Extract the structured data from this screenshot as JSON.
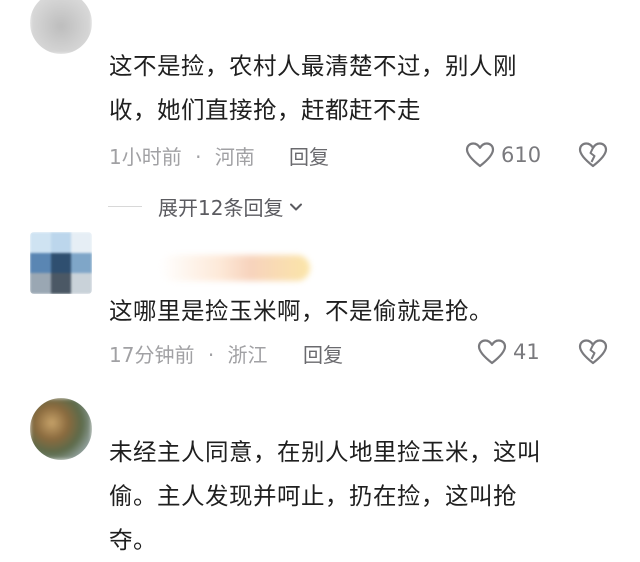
{
  "comments": [
    {
      "username": "",
      "text": "这不是捡，农村人最清楚不过，别人刚\n收，她们直接抢，赶都赶不走",
      "time": "1小时前",
      "location": "河南",
      "reply_label": "回复",
      "likes": "610",
      "expand_label": "展开12条回复",
      "avatar_icon": "blurred-avatar-icon",
      "like_icon": "heart-icon",
      "dislike_icon": "broken-heart-icon"
    },
    {
      "username": "",
      "text": "这哪里是捡玉米啊，不是偷就是抢。",
      "time": "17分钟前",
      "location": "浙江",
      "reply_label": "回复",
      "likes": "41",
      "avatar_icon": "pixelated-avatar-icon",
      "like_icon": "heart-icon",
      "dislike_icon": "broken-heart-icon"
    },
    {
      "username": "",
      "text": "未经主人同意，在别人地里捡玉米，这叫\n偷。主人发现并呵止，扔在捡，这叫抢\n夺。",
      "avatar_icon": "blurred-photo-avatar-icon"
    }
  ],
  "separator": "·",
  "colors": {
    "text": "#1f1f1f",
    "meta": "#a1a1a4",
    "icon": "#7a7a7e"
  }
}
